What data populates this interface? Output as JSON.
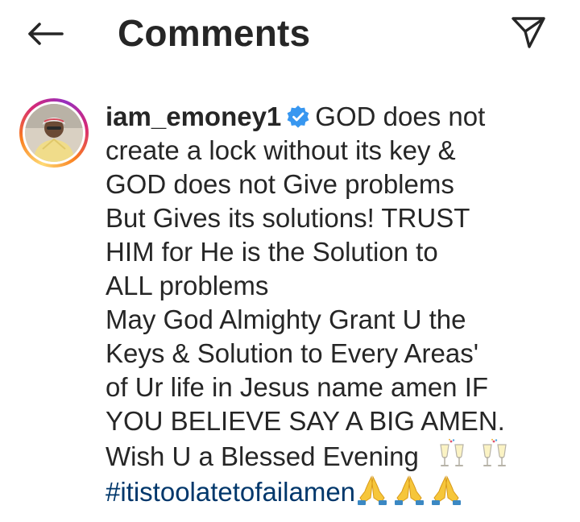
{
  "header": {
    "title": "Comments",
    "back_icon": "arrow-left-icon",
    "share_icon": "paper-plane-icon"
  },
  "comment": {
    "username": "iam_emoney1",
    "verified_icon": "verified-badge-icon",
    "text_lines": [
      "GOD does not",
      "create a lock without its key &",
      "GOD does not Give problems",
      "But Gives its solutions! TRUST",
      "HIM for He is the Solution to",
      "ALL problems",
      "May God Almighty Grant U the",
      "Keys & Solution to Every Areas'",
      "of Ur life in Jesus name amen IF",
      "YOU BELIEVE SAY A BIG AMEN.",
      "Wish U a Blessed Evening"
    ],
    "hashtag": "#itistoolatetofailamen",
    "emojis_after_text": [
      "clinking-glasses-emoji",
      "clinking-glasses-emoji"
    ],
    "emojis_after_hashtag": [
      "folded-hands-emoji",
      "folded-hands-emoji",
      "folded-hands-emoji"
    ]
  },
  "colors": {
    "text": "#262626",
    "hashtag": "#00376b",
    "verified": "#3897f0",
    "background": "#ffffff"
  }
}
